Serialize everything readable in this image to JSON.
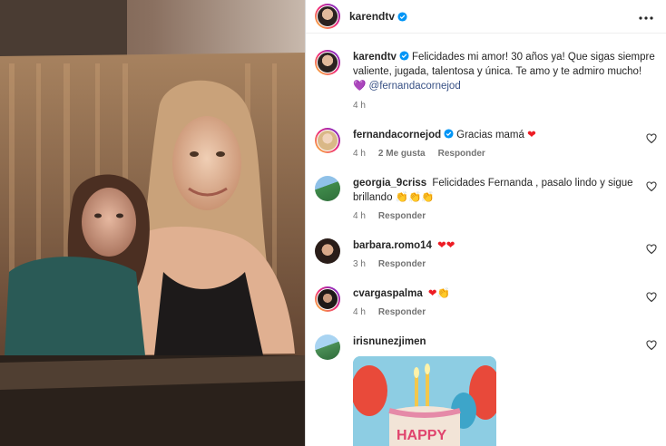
{
  "post": {
    "author": "karendtv",
    "caption_author": "karendtv",
    "caption_text": "Felicidades mi amor! 30 años ya! Que sigas siempre valiente, jugada, talentosa y única. Te amo y te admiro mucho!",
    "caption_emoji": "💜",
    "caption_mention": "@fernandacornejod",
    "caption_time": "4 h"
  },
  "comments": [
    {
      "username": "fernandacornejod",
      "verified": true,
      "text": "Gracias mamá",
      "emoji": "❤",
      "time": "4 h",
      "likes": "2 Me gusta",
      "reply": "Responder"
    },
    {
      "username": "georgia_9criss",
      "text": "Felicidades Fernanda , pasalo lindo y sigue brillando",
      "emoji": "👏👏👏",
      "time": "4 h",
      "reply": "Responder"
    },
    {
      "username": "barbara.romo14",
      "text": "",
      "emoji": "❤❤",
      "time": "3 h",
      "reply": "Responder"
    },
    {
      "username": "cvargaspalma",
      "text": "",
      "emoji": "❤👏",
      "time": "4 h",
      "reply": "Responder"
    },
    {
      "username": "irisnunezjimen",
      "text": "",
      "emoji": "",
      "gif": "HAPPY"
    }
  ],
  "icons": {
    "more": "more-horizontal-icon",
    "verified": "verified-badge-icon",
    "like": "heart-outline-icon"
  },
  "colors": {
    "verified_blue": "#0095f6",
    "mention": "#385185",
    "meta_gray": "#737373"
  }
}
